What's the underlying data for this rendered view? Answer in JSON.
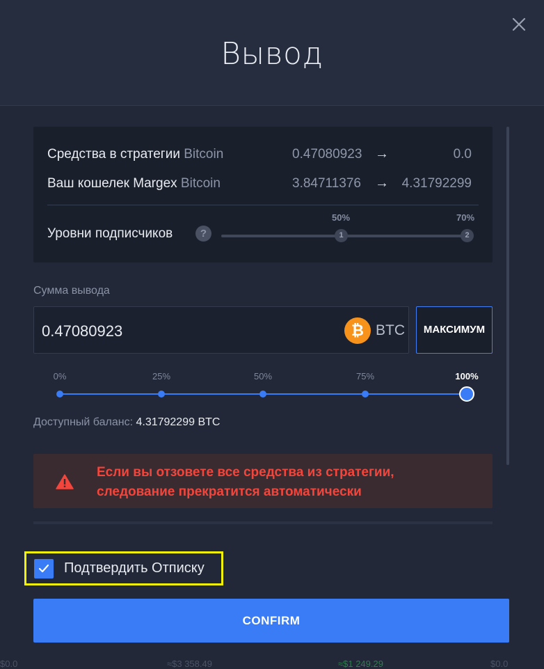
{
  "modal": {
    "title": "Вывод"
  },
  "summary": {
    "rows": [
      {
        "label": "Средства в стратегии",
        "coin": "Bitcoin",
        "from": "0.47080923",
        "arrow": "→",
        "to": "0.0"
      },
      {
        "label": "Ваш кошелек Margex",
        "coin": "Bitcoin",
        "from": "3.84711376",
        "arrow": "→",
        "to": "4.31792299"
      }
    ],
    "tiers": {
      "label": "Уровни подписчиков",
      "help": "?",
      "levels": [
        {
          "node": "1",
          "percent": "50%"
        },
        {
          "node": "2",
          "percent": "70%"
        }
      ]
    }
  },
  "withdraw": {
    "label": "Сумма вывода",
    "amount": "0.47080923",
    "currency": "BTC",
    "currency_icon": "₿",
    "max_button": "МАКСИМУМ",
    "slider": {
      "marks": [
        "0%",
        "25%",
        "50%",
        "75%",
        "100%"
      ],
      "selected_percent": 100
    },
    "balance_label": "Доступный баланс:",
    "balance_value": "4.31792299 BTC"
  },
  "warning": {
    "line1": "Если вы отзовете все средства из стратегии,",
    "line2": "следование прекратится автоматически"
  },
  "confirm_unsubscribe": {
    "label": "Подтвердить Отписку",
    "checked": true
  },
  "confirm_button": "CONFIRM",
  "background": {
    "fragments": [
      "$0.0",
      "≈$3 358.49",
      "≈$1 249.29",
      "$0.0"
    ]
  },
  "colors": {
    "accent": "#3a7cf5",
    "warning_text": "#f2463c",
    "highlight": "#f2f20d",
    "bitcoin": "#f7931a"
  }
}
